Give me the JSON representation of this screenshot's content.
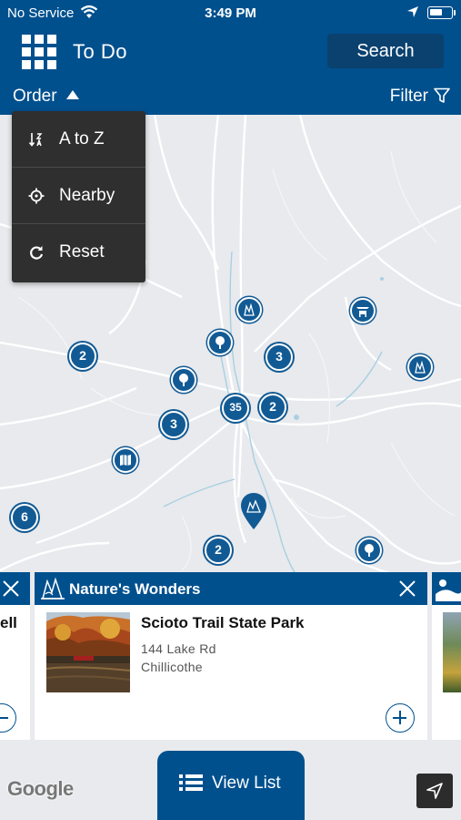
{
  "status_bar": {
    "carrier": "No Service",
    "time": "3:49 PM"
  },
  "header": {
    "title": "To Do",
    "search_label": "Search"
  },
  "subbar": {
    "order_label": "Order",
    "filter_label": "Filter"
  },
  "order_menu": {
    "items": [
      {
        "label": "A to Z",
        "icon": "sort-az-icon"
      },
      {
        "label": "Nearby",
        "icon": "crosshair-icon"
      },
      {
        "label": "Reset",
        "icon": "refresh-icon"
      }
    ]
  },
  "map": {
    "clusters": [
      "2",
      "3",
      "35",
      "2",
      "3",
      "6",
      "2"
    ],
    "attribution": "Google"
  },
  "cards": {
    "left_fragment": {
      "name_fragment": "ell"
    },
    "main": {
      "category": "Nature's Wonders",
      "name": "Scioto Trail State Park",
      "address_line1": "144 Lake Rd",
      "address_line2": "Chillicothe"
    }
  },
  "bottom": {
    "view_list_label": "View List"
  },
  "colors": {
    "brand_blue": "#00508e",
    "marker_blue": "#125a94",
    "menu_bg": "#2f2f2f"
  }
}
